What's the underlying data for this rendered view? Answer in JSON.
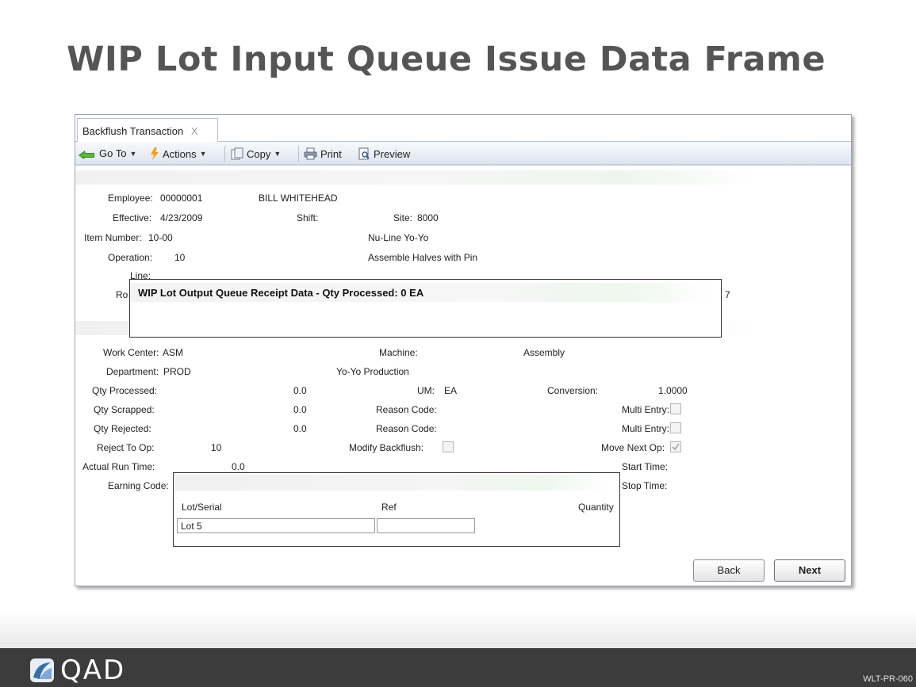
{
  "slide": {
    "title": "WIP Lot Input Queue Issue Data Frame",
    "code": "WLT-PR-060",
    "logo_text": "QAD"
  },
  "window": {
    "tab_label": "Backflush Transaction",
    "tab_close": "X",
    "toolbar": {
      "goto": "Go To",
      "actions": "Actions",
      "copy": "Copy",
      "print": "Print",
      "preview": "Preview"
    }
  },
  "header_fields": {
    "employee_label": "Employee:",
    "employee_value": "00000001",
    "employee_name": "BILL WHITEHEAD",
    "effective_label": "Effective:",
    "effective_value": "4/23/2009",
    "shift_label": "Shift:",
    "site_label": "Site:",
    "site_value": "8000",
    "item_label": "Item Number:",
    "item_value": "10-00",
    "item_desc": "Nu-Line Yo-Yo",
    "operation_label": "Operation:",
    "operation_value": "10",
    "operation_desc": "Assemble Halves with Pin",
    "line_label": "Line:",
    "ro_partial": "Ro",
    "right_partial": "7"
  },
  "popup_receipt": {
    "title": "WIP Lot Output Queue Receipt Data - Qty Processed: 0 EA"
  },
  "detail_fields": {
    "work_center_label": "Work Center:",
    "work_center_value": "ASM",
    "machine_label": "Machine:",
    "machine_value": "Assembly",
    "department_label": "Department:",
    "department_value": "PROD",
    "department_desc": "Yo-Yo Production",
    "qty_processed_label": "Qty Processed:",
    "qty_processed_value": "0.0",
    "um_label": "UM:",
    "um_value": "EA",
    "conversion_label": "Conversion:",
    "conversion_value": "1.0000",
    "qty_scrapped_label": "Qty Scrapped:",
    "qty_scrapped_value": "0.0",
    "reason_code_label_1": "Reason Code:",
    "multi_entry_label_1": "Multi Entry:",
    "qty_rejected_label": "Qty Rejected:",
    "qty_rejected_value": "0.0",
    "reason_code_label_2": "Reason Code:",
    "multi_entry_label_2": "Multi Entry:",
    "reject_to_op_label": "Reject To Op:",
    "reject_to_op_value": "10",
    "modify_backflush_label": "Modify Backflush:",
    "move_next_op_label": "Move Next Op:",
    "actual_run_time_label": "Actual Run Time:",
    "actual_run_time_value": "0.0",
    "start_time_label": "Start Time:",
    "earning_code_label": "Earning Code:",
    "stop_time_label": "Stop Time:"
  },
  "popup_lot": {
    "col_lot": "Lot/Serial",
    "col_ref": "Ref",
    "col_qty": "Quantity",
    "lot_value": "Lot 5",
    "ref_value": ""
  },
  "buttons": {
    "back": "Back",
    "next": "Next"
  },
  "colors": {
    "title_gray": "#555555",
    "footer_dark": "#3c3c3c",
    "toolbar_blue": "#dfe4ee"
  }
}
